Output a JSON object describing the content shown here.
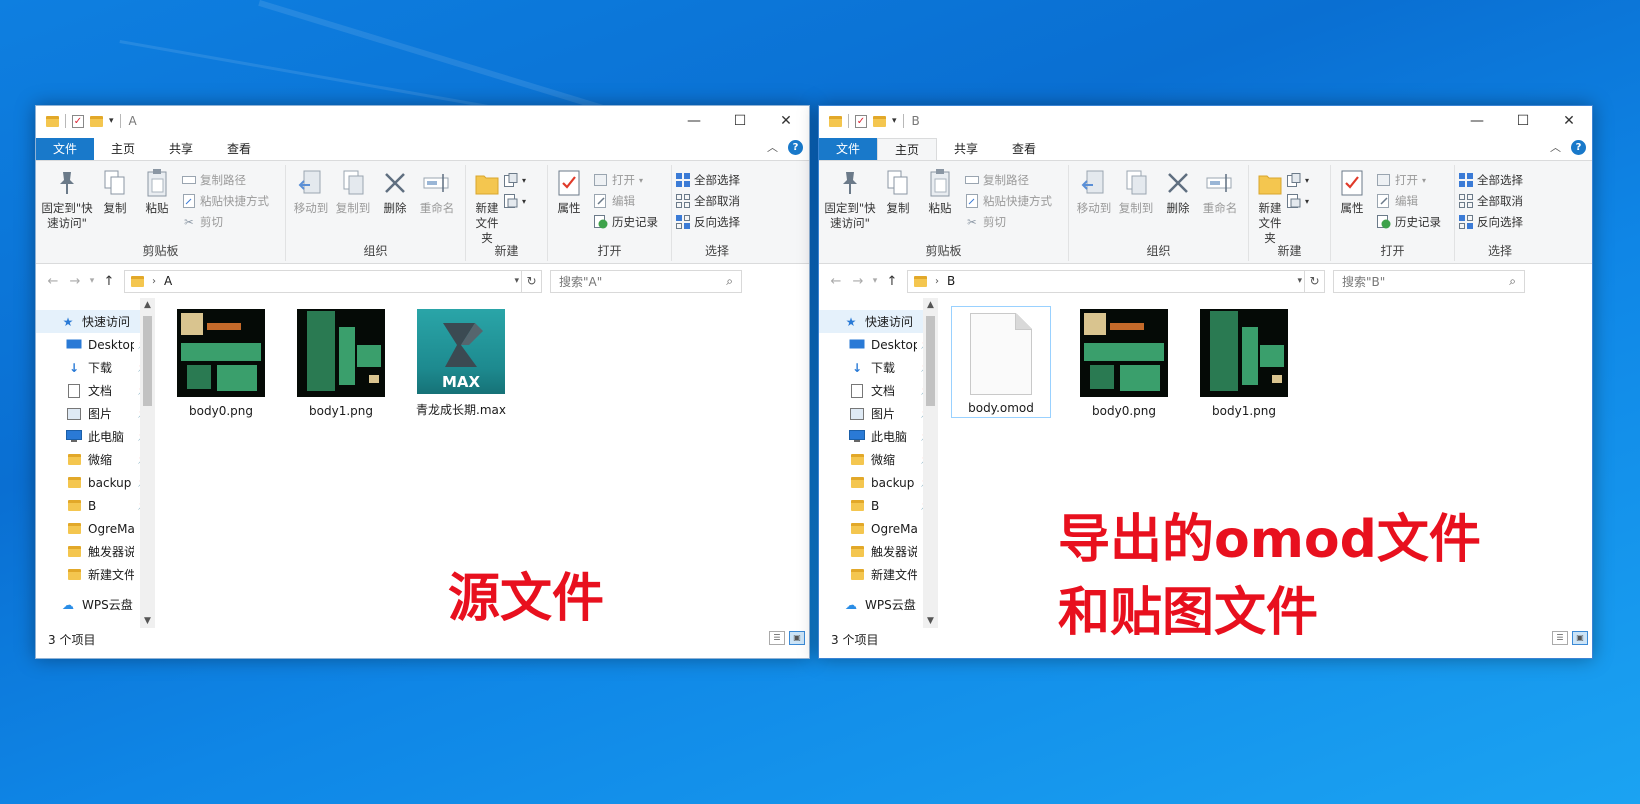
{
  "colors": {
    "desktop": "#0f7fe0",
    "file_tab": "#1979ca",
    "caption": "#e8101e"
  },
  "ribbon": {
    "tabs": [
      "文件",
      "主页",
      "共享",
      "查看"
    ],
    "clipboard": {
      "pin_label": "固定到\"快速访问\"",
      "copy": "复制",
      "paste": "粘贴",
      "copy_path": "复制路径",
      "paste_shortcut": "粘贴快捷方式",
      "cut": "剪切",
      "group": "剪贴板"
    },
    "organize": {
      "move_to": "移动到",
      "copy_to": "复制到",
      "delete": "删除",
      "rename": "重命名",
      "group": "组织"
    },
    "new": {
      "new_folder": "新建\n文件夹",
      "group": "新建"
    },
    "open": {
      "properties": "属性",
      "open": "打开",
      "edit": "编辑",
      "history": "历史记录",
      "group": "打开"
    },
    "select": {
      "select_all": "全部选择",
      "select_none": "全部取消",
      "invert": "反向选择",
      "group": "选择"
    }
  },
  "nav": {
    "quick_access": "快速访问",
    "items": [
      "Desktop",
      "下载",
      "文档",
      "图片",
      "此电脑",
      "微缩",
      "backup",
      "B",
      "OgreMax",
      "触发器说明",
      "新建文件夹"
    ],
    "cloud": "WPS云盘"
  },
  "windows": [
    {
      "title": "A",
      "active_tab": "文件",
      "address": "A",
      "search_placeholder": "搜索\"A\"",
      "files": [
        "body0.png",
        "body1.png",
        "青龙成长期.max"
      ],
      "max_label": "MAX",
      "status": "3 个项目"
    },
    {
      "title": "B",
      "active_tab": "主页",
      "address": "B",
      "search_placeholder": "搜索\"B\"",
      "files": [
        "body.omod",
        "body0.png",
        "body1.png"
      ],
      "status": "3 个项目"
    }
  ],
  "captions": {
    "left": "源文件",
    "right_line1": "导出的omod文件",
    "right_line2": "和贴图文件"
  }
}
